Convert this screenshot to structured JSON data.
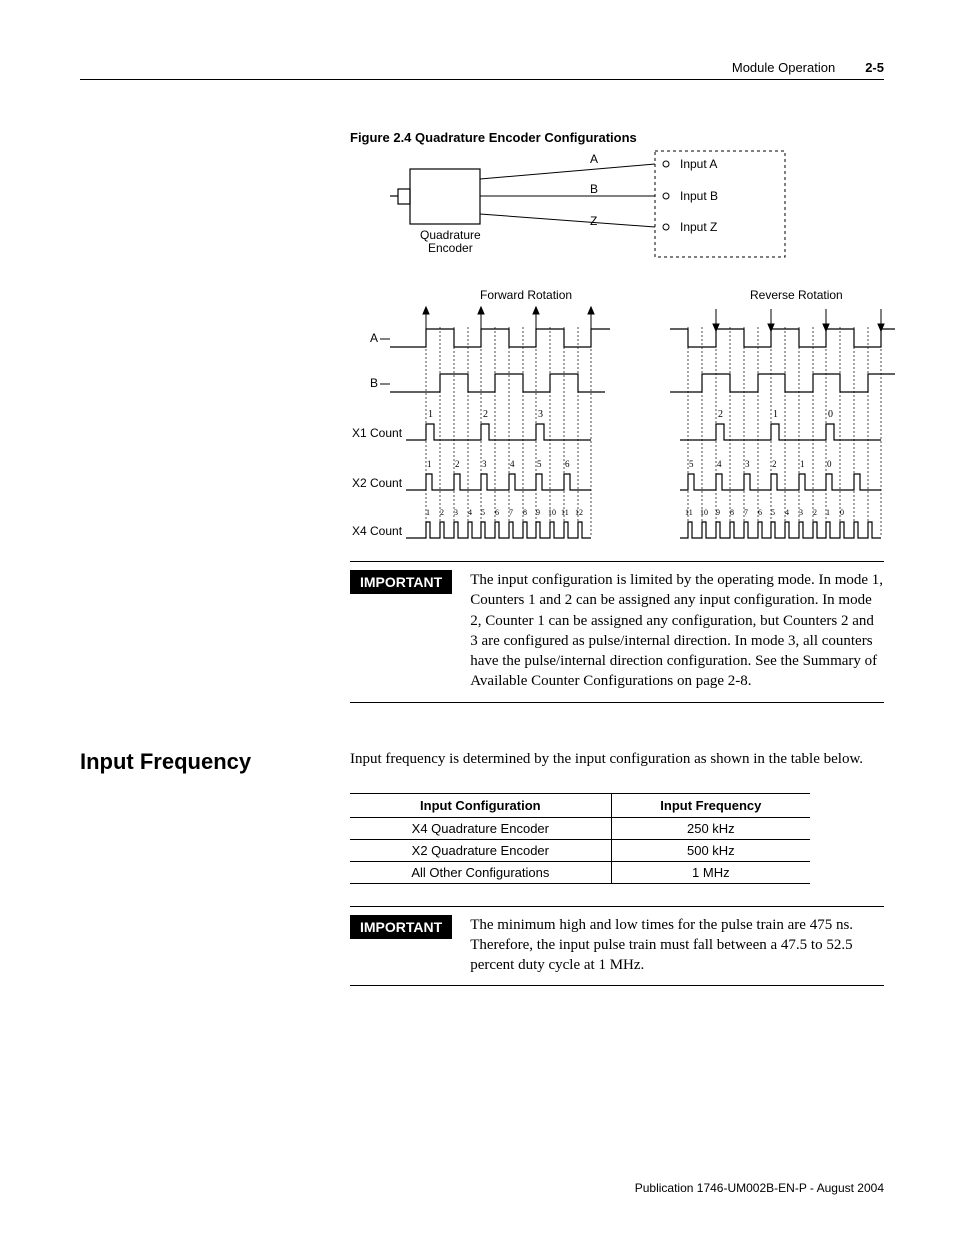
{
  "header": {
    "section": "Module Operation",
    "page": "2-5"
  },
  "figure": {
    "caption": "Figure 2.4 Quadrature Encoder Configurations",
    "encoder_label": "Quadrature Encoder",
    "signals": [
      "A",
      "B",
      "Z"
    ],
    "inputs": [
      "Input A",
      "Input B",
      "Input Z"
    ],
    "forward": "Forward Rotation",
    "reverse": "Reverse Rotation",
    "row_labels": [
      "A",
      "B",
      "X1 Count",
      "X2 Count",
      "X4 Count"
    ],
    "x1_counts_fwd": [
      "1",
      "2",
      "3"
    ],
    "x1_counts_rev": [
      "2",
      "1",
      "0"
    ],
    "x2_counts_fwd": [
      "1",
      "2",
      "3",
      "4",
      "5",
      "6"
    ],
    "x2_counts_rev": [
      "5",
      "4",
      "3",
      "2",
      "1",
      "0"
    ],
    "x4_counts_fwd": [
      "1",
      "2",
      "3",
      "4",
      "5",
      "6",
      "7",
      "8",
      "9",
      "10",
      "11",
      "12"
    ],
    "x4_counts_rev": [
      "11",
      "10",
      "9",
      "8",
      "7",
      "6",
      "5",
      "4",
      "3",
      "2",
      "1",
      "0"
    ]
  },
  "important1": {
    "badge": "IMPORTANT",
    "text": "The input configuration is limited by the operating mode. In mode 1, Counters 1 and 2 can be assigned any input configuration. In mode 2, Counter 1 can be assigned any configuration, but Counters 2 and 3 are configured as pulse/internal direction. In mode 3, all counters have the pulse/internal direction configuration. See the Summary of Available Counter Configurations on page 2-8."
  },
  "section": {
    "heading": "Input Frequency",
    "intro": "Input frequency is determined by the input configuration as shown in the table below."
  },
  "freq_table": {
    "headers": [
      "Input Configuration",
      "Input Frequency"
    ],
    "rows": [
      [
        "X4 Quadrature Encoder",
        "250 kHz"
      ],
      [
        "X2 Quadrature Encoder",
        "500 kHz"
      ],
      [
        "All Other Configurations",
        "1 MHz"
      ]
    ]
  },
  "important2": {
    "badge": "IMPORTANT",
    "text": "The minimum high and low times for the pulse train are 475 ns. Therefore, the input pulse train must fall between a 47.5 to 52.5 percent duty cycle at 1 MHz."
  },
  "publication": "Publication 1746-UM002B-EN-P - August 2004"
}
